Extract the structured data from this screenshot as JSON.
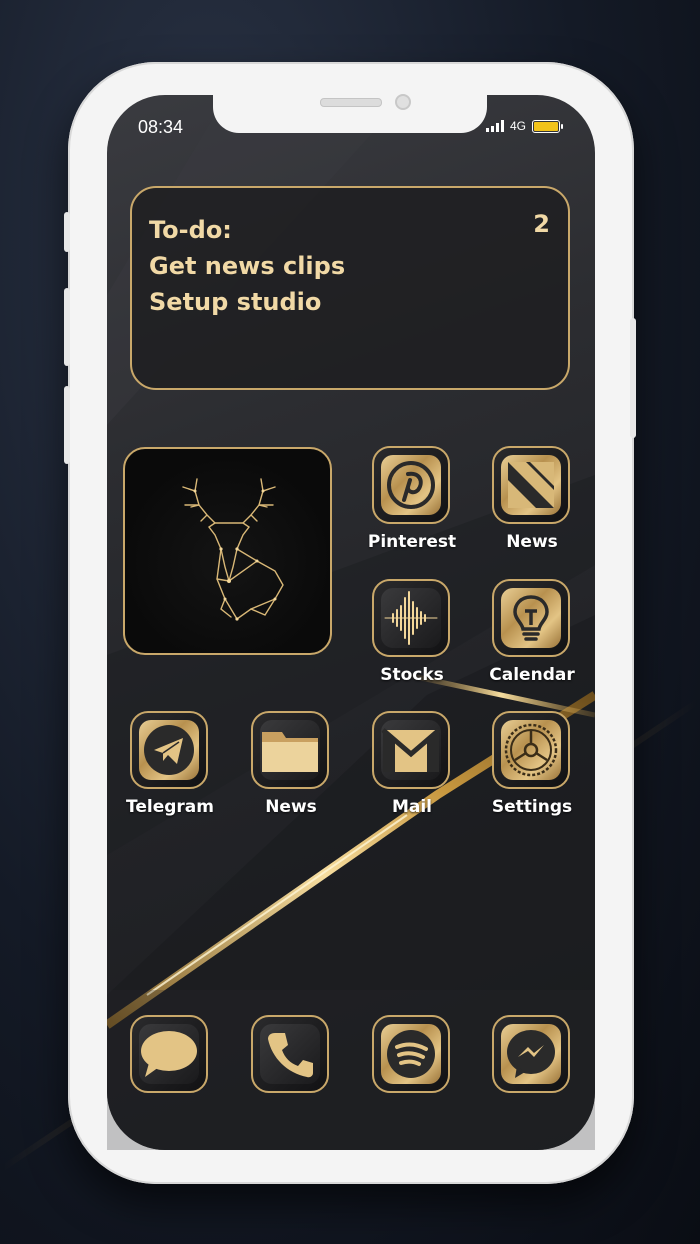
{
  "status_bar": {
    "time": "08:34",
    "network": "4G",
    "battery_color": "#f2c31a"
  },
  "todo_widget": {
    "title": "To-do:",
    "items": [
      "Get news clips",
      "Setup studio"
    ],
    "count": "2"
  },
  "photo_widget": {
    "subject": "deer-illustration"
  },
  "apps": [
    {
      "label": "Pinterest",
      "icon": "pinterest-icon"
    },
    {
      "label": "News",
      "icon": "news-icon"
    },
    {
      "label": "Stocks",
      "icon": "soundwave-icon"
    },
    {
      "label": "Calendar",
      "icon": "lightbulb-icon"
    },
    {
      "label": "Telegram",
      "icon": "paper-plane-icon"
    },
    {
      "label": "News",
      "icon": "folder-icon"
    },
    {
      "label": "Mail",
      "icon": "envelope-icon"
    },
    {
      "label": "Settings",
      "icon": "gear-icon"
    }
  ],
  "dock": [
    {
      "icon": "message-bubble-icon"
    },
    {
      "icon": "phone-icon"
    },
    {
      "icon": "spotify-icon"
    },
    {
      "icon": "messenger-icon"
    }
  ],
  "colors": {
    "accent_gold": "#c9a86a",
    "text_gold": "#f1d9a6"
  }
}
